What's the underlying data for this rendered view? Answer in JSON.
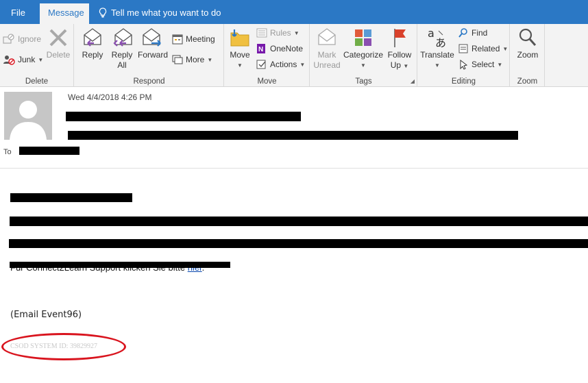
{
  "tabs": {
    "file": "File",
    "message": "Message",
    "tell_me": "Tell me what you want to do"
  },
  "ribbon": {
    "delete_group": {
      "label": "Delete",
      "ignore": "Ignore",
      "junk": "Junk",
      "delete": "Delete"
    },
    "respond_group": {
      "label": "Respond",
      "reply": "Reply",
      "reply_all_1": "Reply",
      "reply_all_2": "All",
      "forward": "Forward",
      "meeting": "Meeting",
      "more": "More"
    },
    "move_group": {
      "label": "Move",
      "move": "Move",
      "rules": "Rules",
      "onenote": "OneNote",
      "actions": "Actions"
    },
    "tags_group": {
      "label": "Tags",
      "mark_unread_1": "Mark",
      "mark_unread_2": "Unread",
      "categorize": "Categorize",
      "follow_up_1": "Follow",
      "follow_up_2": "Up"
    },
    "editing_group": {
      "label": "Editing",
      "translate": "Translate",
      "find": "Find",
      "related": "Related",
      "select": "Select"
    },
    "zoom_group": {
      "label": "Zoom",
      "zoom": "Zoom"
    }
  },
  "header": {
    "date": "Wed 4/4/2018 4:26 PM",
    "to_label": "To"
  },
  "body": {
    "line4_prefix": "Für Connect2Learn Support klicken Sie bitte ",
    "link_text": "hier",
    "line4_suffix": ".",
    "event": "(Email Event96)",
    "csod": "CSOD SYSTEM ID: 39829927"
  },
  "colors": {
    "accent": "#2b78c5",
    "annotation": "#d9141e"
  }
}
